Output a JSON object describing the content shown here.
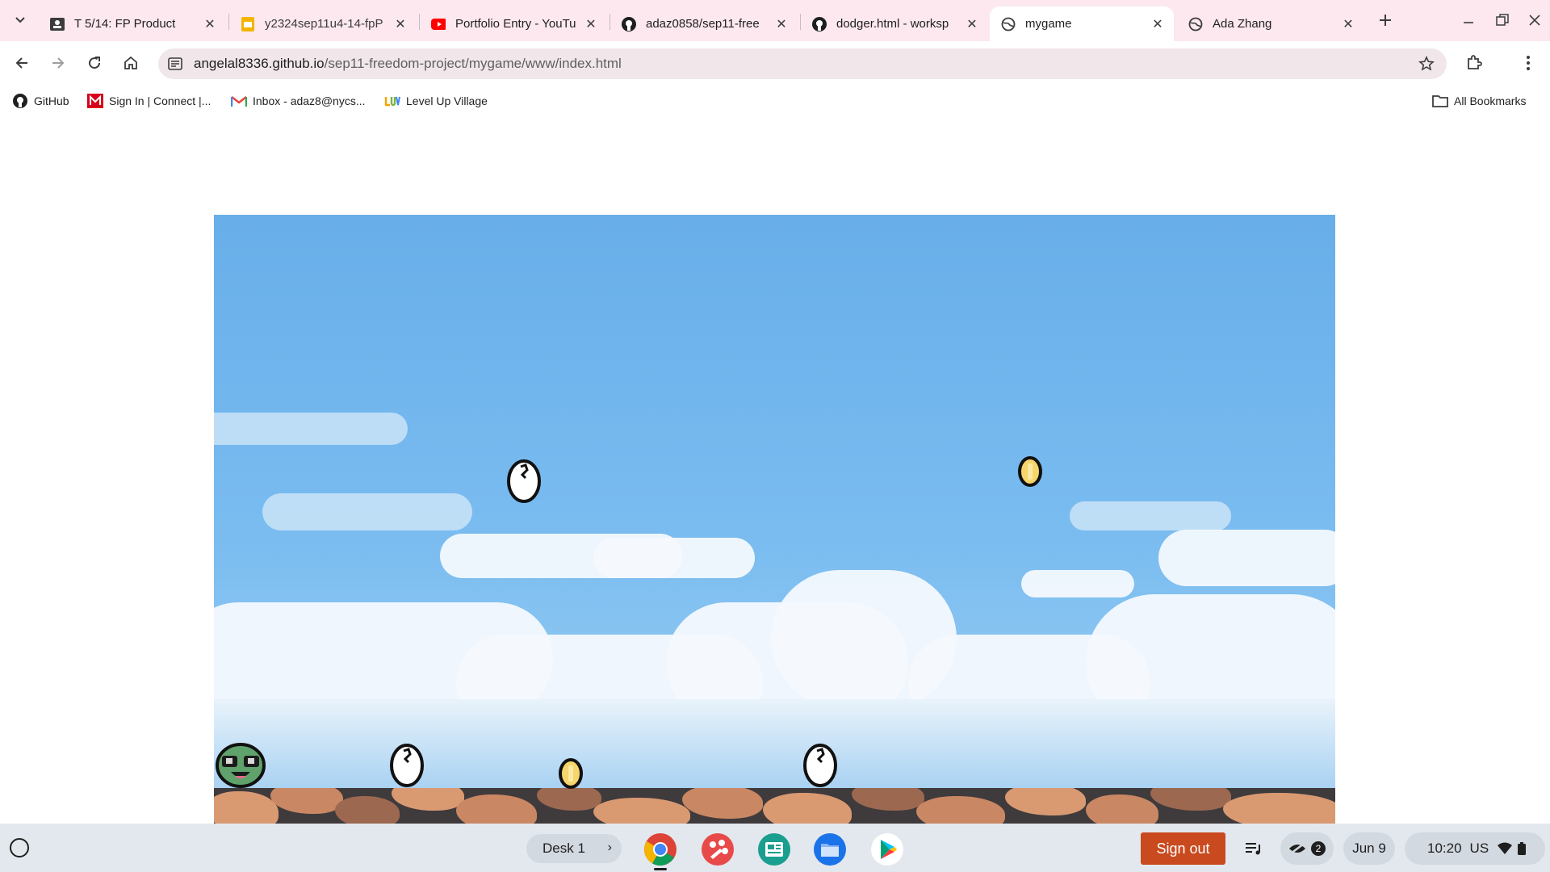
{
  "browser": {
    "tabs": [
      {
        "title": "T 5/14: FP Product",
        "icon": "classroom-icon",
        "active": false
      },
      {
        "title": "y2324sep11u4-14-fpP",
        "icon": "slides-icon",
        "active": false
      },
      {
        "title": "Portfolio Entry - YouTu",
        "icon": "youtube-icon",
        "active": false
      },
      {
        "title": "adaz0858/sep11-free",
        "icon": "github-icon",
        "active": false
      },
      {
        "title": "dodger.html - worksp",
        "icon": "github-icon",
        "active": false
      },
      {
        "title": "mygame",
        "icon": "globe-icon",
        "active": true
      },
      {
        "title": "Ada Zhang",
        "icon": "globe-icon",
        "active": false
      }
    ],
    "url_host": "angelal8336.github.io",
    "url_path": "/sep11-freedom-project/mygame/www/index.html",
    "bookmarks": [
      {
        "label": "GitHub",
        "icon": "github-icon"
      },
      {
        "label": "Sign In | Connect |...",
        "icon": "mcgraw-icon"
      },
      {
        "label": "Inbox - adaz8@nycs...",
        "icon": "gmail-icon"
      },
      {
        "label": "Level Up Village",
        "icon": "luv-icon"
      }
    ],
    "all_bookmarks_label": "All Bookmarks"
  },
  "game": {
    "player": "frog-face",
    "objects": [
      {
        "kind": "egg",
        "label": "egg-enemy"
      },
      {
        "kind": "coin",
        "label": "coin"
      },
      {
        "kind": "egg",
        "label": "egg-enemy"
      },
      {
        "kind": "coin",
        "label": "coin"
      },
      {
        "kind": "egg",
        "label": "egg-enemy"
      }
    ]
  },
  "shelf": {
    "desk_label": "Desk 1",
    "sign_out_label": "Sign out",
    "notification_count": "2",
    "date": "Jun 9",
    "time": "10:20",
    "locale": "US"
  },
  "colors": {
    "tabstrip": "#fce8ee",
    "sky": "#72b6ee",
    "sign_out": "#c84a1e"
  }
}
